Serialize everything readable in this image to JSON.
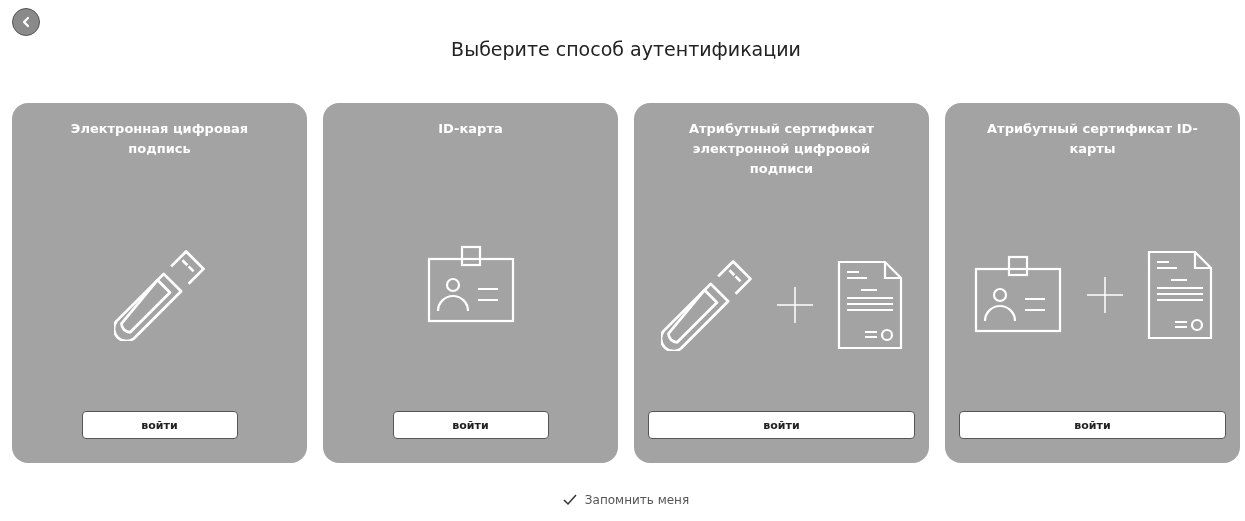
{
  "title": "Выберите способ аутентификации",
  "methods": [
    {
      "title": "Электронная цифровая подпись",
      "icons": [
        {
          "kind": "usb"
        }
      ],
      "button": "войти"
    },
    {
      "title": "ID-карта",
      "icons": [
        {
          "kind": "id-card"
        }
      ],
      "button": "войти"
    },
    {
      "title": "Атрибутный сертификат электронной цифровой подписи",
      "icons": [
        {
          "kind": "usb"
        },
        {
          "kind": "document"
        }
      ],
      "button": "войти"
    },
    {
      "title": "Атрибутный сертификат ID-карты",
      "icons": [
        {
          "kind": "id-card"
        },
        {
          "kind": "document"
        }
      ],
      "button": "войти"
    }
  ],
  "remember": {
    "label": "Запомнить меня",
    "checked": true
  }
}
